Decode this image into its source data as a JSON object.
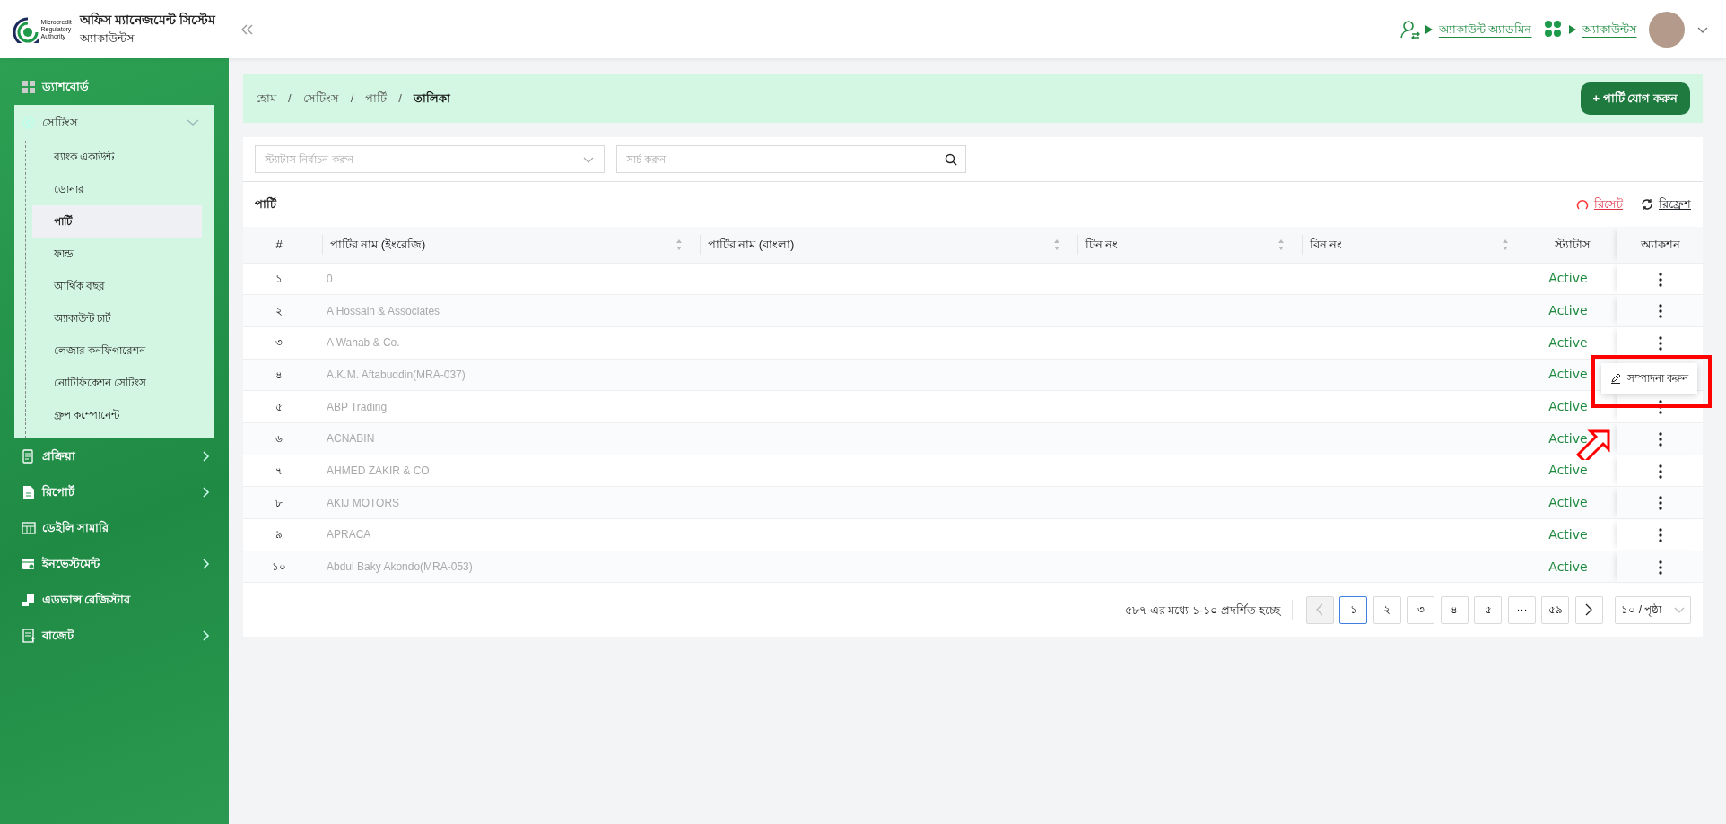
{
  "header": {
    "logo_caption": [
      "Microcredit",
      "Regulatory",
      "Authority"
    ],
    "title": "অফিস ম্যানেজমেন্ট সিস্টেম",
    "subtitle": "অ্যাকাউন্টস",
    "links": [
      {
        "label": "অ্যাকাউন্ট অ্যাডমিন",
        "kind": "user"
      },
      {
        "label": "অ্যাকাউন্টস",
        "kind": "apps"
      }
    ]
  },
  "sidebar": {
    "items": [
      {
        "label": "ড্যাশবোর্ড",
        "kind": "dashboard",
        "has_children": false
      },
      {
        "label": "সেটিংস",
        "kind": "settings",
        "has_children": true,
        "expanded": true,
        "children": [
          {
            "label": "ব্যাংক একাউন্ট",
            "selected": false
          },
          {
            "label": "ডোনার",
            "selected": false
          },
          {
            "label": "পার্টি",
            "selected": true
          },
          {
            "label": "ফান্ড",
            "selected": false
          },
          {
            "label": "আর্থিক বছর",
            "selected": false
          },
          {
            "label": "অ্যাকাউন্ট চার্ট",
            "selected": false
          },
          {
            "label": "লেজার কনফিগারেশন",
            "selected": false
          },
          {
            "label": "নোটিফিকেশন সেটিংস",
            "selected": false
          },
          {
            "label": "গ্রুপ কম্পোনেন্ট",
            "selected": false
          }
        ]
      },
      {
        "label": "প্রক্রিয়া",
        "kind": "process",
        "has_children": true,
        "expanded": false
      },
      {
        "label": "রিপোর্ট",
        "kind": "report",
        "has_children": true,
        "expanded": false
      },
      {
        "label": "ডেইলি সামারি",
        "kind": "summary",
        "has_children": false
      },
      {
        "label": "ইনভেস্টমেন্ট",
        "kind": "investment",
        "has_children": true,
        "expanded": false
      },
      {
        "label": "এডভান্স রেজিস্টার",
        "kind": "register",
        "has_children": false
      },
      {
        "label": "বাজেট",
        "kind": "budget",
        "has_children": true,
        "expanded": false
      }
    ]
  },
  "breadcrumb": {
    "separator": "/",
    "items": [
      "হোম",
      "সেটিংস",
      "পার্টি",
      "তালিকা"
    ]
  },
  "add_button": "+ পার্টি যোগ করুন",
  "filters": {
    "status_placeholder": "স্ট্যাটাস নির্বাচন করুন",
    "search_placeholder": "সার্চ করুন"
  },
  "card": {
    "title": "পার্টি",
    "reset": "রিসেট",
    "refresh": "রিফ্রেশ"
  },
  "table": {
    "columns": [
      {
        "label": "#",
        "sortable": false
      },
      {
        "label": "পার্টির নাম (ইংরেজি)",
        "sortable": true
      },
      {
        "label": "পার্টির নাম (বাংলা)",
        "sortable": true
      },
      {
        "label": "টিন নং",
        "sortable": true
      },
      {
        "label": "বিন নং",
        "sortable": true
      },
      {
        "label": "স্ট্যাটাস",
        "sortable": false
      },
      {
        "label": "অ্যাকশন",
        "sortable": false
      }
    ],
    "rows": [
      {
        "no": "১",
        "name_en": "0",
        "status": "Active"
      },
      {
        "no": "২",
        "name_en": "A Hossain & Associates",
        "status": "Active"
      },
      {
        "no": "৩",
        "name_en": "A Wahab & Co.",
        "status": "Active"
      },
      {
        "no": "৪",
        "name_en": "A.K.M. Aftabuddin(MRA-037)",
        "status": "Active"
      },
      {
        "no": "৫",
        "name_en": "ABP Trading",
        "status": "Active"
      },
      {
        "no": "৬",
        "name_en": "ACNABIN",
        "status": "Active"
      },
      {
        "no": "৭",
        "name_en": "AHMED ZAKIR & CO.",
        "status": "Active"
      },
      {
        "no": "৮",
        "name_en": "AKIJ MOTORS",
        "status": "Active"
      },
      {
        "no": "৯",
        "name_en": "APRACA",
        "status": "Active"
      },
      {
        "no": "১০",
        "name_en": "Abdul Baky Akondo(MRA-053)",
        "status": "Active"
      }
    ]
  },
  "action_menu": {
    "items": [
      "সম্পাদনা করুন"
    ],
    "highlighted": true
  },
  "pagination": {
    "summary": "৫৮৭ এর মধ্যে ১-১০ প্রদর্শিত হচ্ছে",
    "prev_disabled": true,
    "pages": [
      {
        "label": "১",
        "selected": true
      },
      {
        "label": "২",
        "selected": false
      },
      {
        "label": "৩",
        "selected": false
      },
      {
        "label": "৪",
        "selected": false
      },
      {
        "label": "৫",
        "selected": false
      },
      {
        "label": "···",
        "selected": false
      },
      {
        "label": "৫৯",
        "selected": false
      }
    ],
    "per_page": "১০ / পৃষ্ঠা"
  }
}
